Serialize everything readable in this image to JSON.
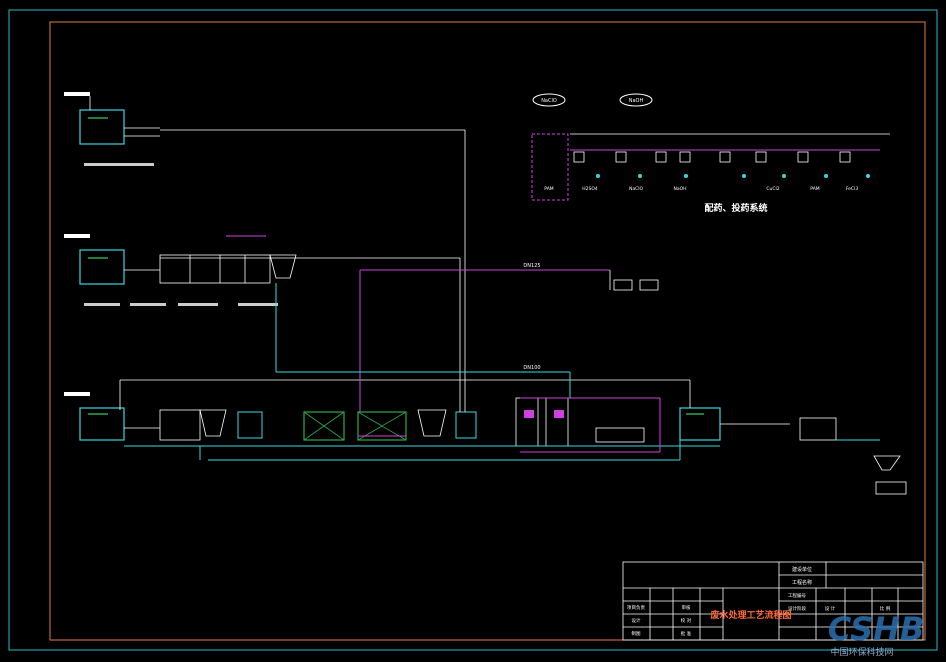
{
  "drawing": {
    "title": "废水处理工艺流程图",
    "section_title": "配药、投药系统",
    "pipe_label_1": "DN125",
    "pipe_label_2": "DN100",
    "chem_tank_1": "NaClO",
    "chem_tank_2": "NaOH",
    "chem_labels": [
      "PAM",
      "H2SO4",
      "NaClO",
      "NaOH",
      "CuCl2",
      "PAM",
      "FeCl3"
    ]
  },
  "title_block": {
    "build_unit": "建设单位",
    "project_name": "工程名称",
    "project_no": "工程编号",
    "design_stage": "设计阶段",
    "scale": "比 例",
    "design_label": "设 计",
    "review_label": "审核",
    "approve_label": "批 准",
    "checker": "校 对",
    "drafter": "制 图",
    "proofread": "审 定",
    "sheet": "图号",
    "date": "日期",
    "project_lead": "项目负责",
    "designer": "设计",
    "draftsman": "制图"
  },
  "watermark": {
    "logo": "CSHB",
    "subtitle": "中国环保科技网"
  },
  "colors": {
    "frame_outer": "#2bb7c3",
    "frame_inner": "#e07a4a",
    "pipe_cyan": "#3dd6e0",
    "pipe_magenta": "#d040e0",
    "pipe_white": "#ffffff",
    "equipment_green": "#2ea84a",
    "title_red": "#ff6a3a"
  }
}
